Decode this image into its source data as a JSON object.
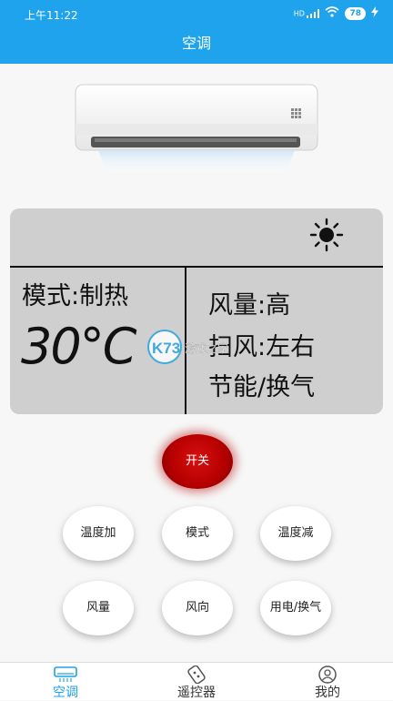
{
  "status_bar": {
    "time": "上午11:22",
    "signal": "HD",
    "battery": "78"
  },
  "title": "空调",
  "display": {
    "mode": "模式:制热",
    "temperature": "30°C",
    "fan": "风量:高",
    "swing": "扫风:左右",
    "saving": "节能/换气",
    "indicator_icon": "sun-icon"
  },
  "watermark": {
    "logo": "K73",
    "text": "游戏之家"
  },
  "power_button": "开关",
  "buttons": [
    "温度加",
    "模式",
    "温度减",
    "风量",
    "风向",
    "用电/换气"
  ],
  "tabs": [
    {
      "label": "空调",
      "icon": "air-conditioner-icon",
      "active": true
    },
    {
      "label": "遥控器",
      "icon": "remote-icon",
      "active": false
    },
    {
      "label": "我的",
      "icon": "user-icon",
      "active": false
    }
  ],
  "colors": {
    "accent": "#1fa3ec",
    "power": "#c00000",
    "display_bg": "#cfcfcf"
  }
}
